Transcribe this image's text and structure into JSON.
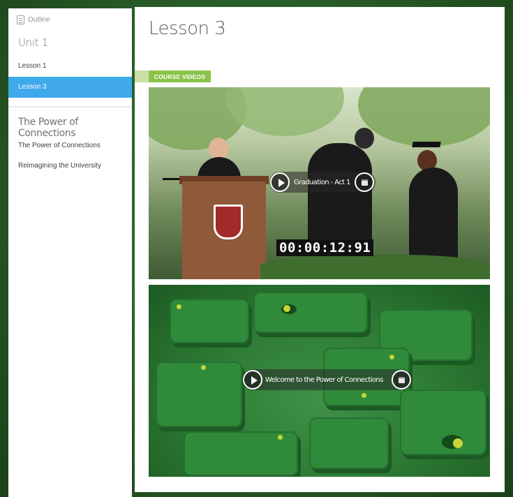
{
  "sidebar": {
    "outline_label": "Outline",
    "unit_title": "Unit 1",
    "items": [
      {
        "label": "Lesson 1",
        "active": false
      },
      {
        "label": "Lesson 3",
        "active": true
      }
    ],
    "section_title": "The Power of Connections",
    "section_items": [
      {
        "label": "The Power of Connections"
      },
      {
        "label": "Reimagining the University"
      }
    ],
    "active_color": "#3fa9ec"
  },
  "main": {
    "page_title": "Lesson 3",
    "tag_label": "COURSE VIDEOS",
    "tag_color": "#8bc34a",
    "videos": [
      {
        "title": "Graduation - Act 1",
        "timecode": "00:00:12:91",
        "play_icon": "play-icon",
        "transcript_icon": "transcript-icon"
      },
      {
        "title": "Welcome to the Power of Connections",
        "play_icon": "play-icon",
        "transcript_icon": "transcript-icon"
      }
    ]
  }
}
